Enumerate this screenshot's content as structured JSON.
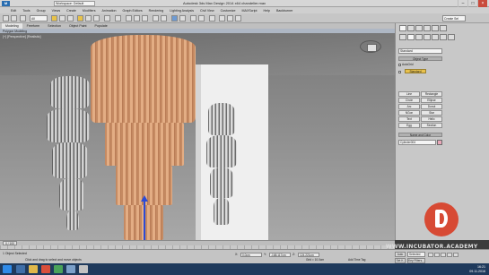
{
  "window": {
    "app_icon": "3ds-max-icon",
    "workspace": "Workspace: Default",
    "title": "Autodesk 3ds Max Design 2014 x64    chandelier.max",
    "controls": [
      "minimize",
      "maximize",
      "close"
    ]
  },
  "menu": {
    "items": [
      "Edit",
      "Tools",
      "Group",
      "Views",
      "Create",
      "Modifiers",
      "Animation",
      "Graph Editors",
      "Rendering",
      "Lighting Analysis",
      "Civil View",
      "Customize",
      "MAXScript",
      "Help",
      "Backburner"
    ]
  },
  "toolbar": {
    "filter": "All",
    "create_selection_set": "Create Sel"
  },
  "ribbon": {
    "tabs": [
      "Modeling",
      "Freeform",
      "Selection",
      "Object Paint",
      "Populate"
    ],
    "active_tab": "Modeling",
    "panel_label": "Polygon Modeling"
  },
  "viewport": {
    "label": "[+] [Perspective] [Realistic]"
  },
  "command_panel": {
    "category": "Standard",
    "rollout_object_type": "Object Type",
    "autogrid_label": "AutoGrid",
    "autogrid_highlight": "Standard",
    "buttons": [
      "Line",
      "Rectangle",
      "Circle",
      "Ellipse",
      "Arc",
      "Donut",
      "NGon",
      "Star",
      "Text",
      "Helix",
      "Egg",
      "Section"
    ],
    "rollout_name_color": "Name and Color",
    "object_name": "Cylinder004",
    "object_color": "#e9a7b8"
  },
  "timeline": {
    "frame": "0 / 100"
  },
  "status": {
    "selection": "1 Object Selected",
    "prompt": "Click and drag to select and move objects",
    "x_value": "0.0cm",
    "y_value": "-168.117cm",
    "z_value": "124.221cm",
    "grid": "Grid = 10.0cm",
    "add_time_tag": "Add Time Tag",
    "auto_key": "Auto",
    "selected_mode": "Selected",
    "set_key": "Set K.",
    "key_filters": "Key Filters..."
  },
  "watermark": {
    "text": "WWW.INCUBATOR.ACADEMY",
    "logo": "incubator-academy-logo"
  },
  "taskbar": {
    "time": "16:21",
    "date": "09.11.2016"
  }
}
